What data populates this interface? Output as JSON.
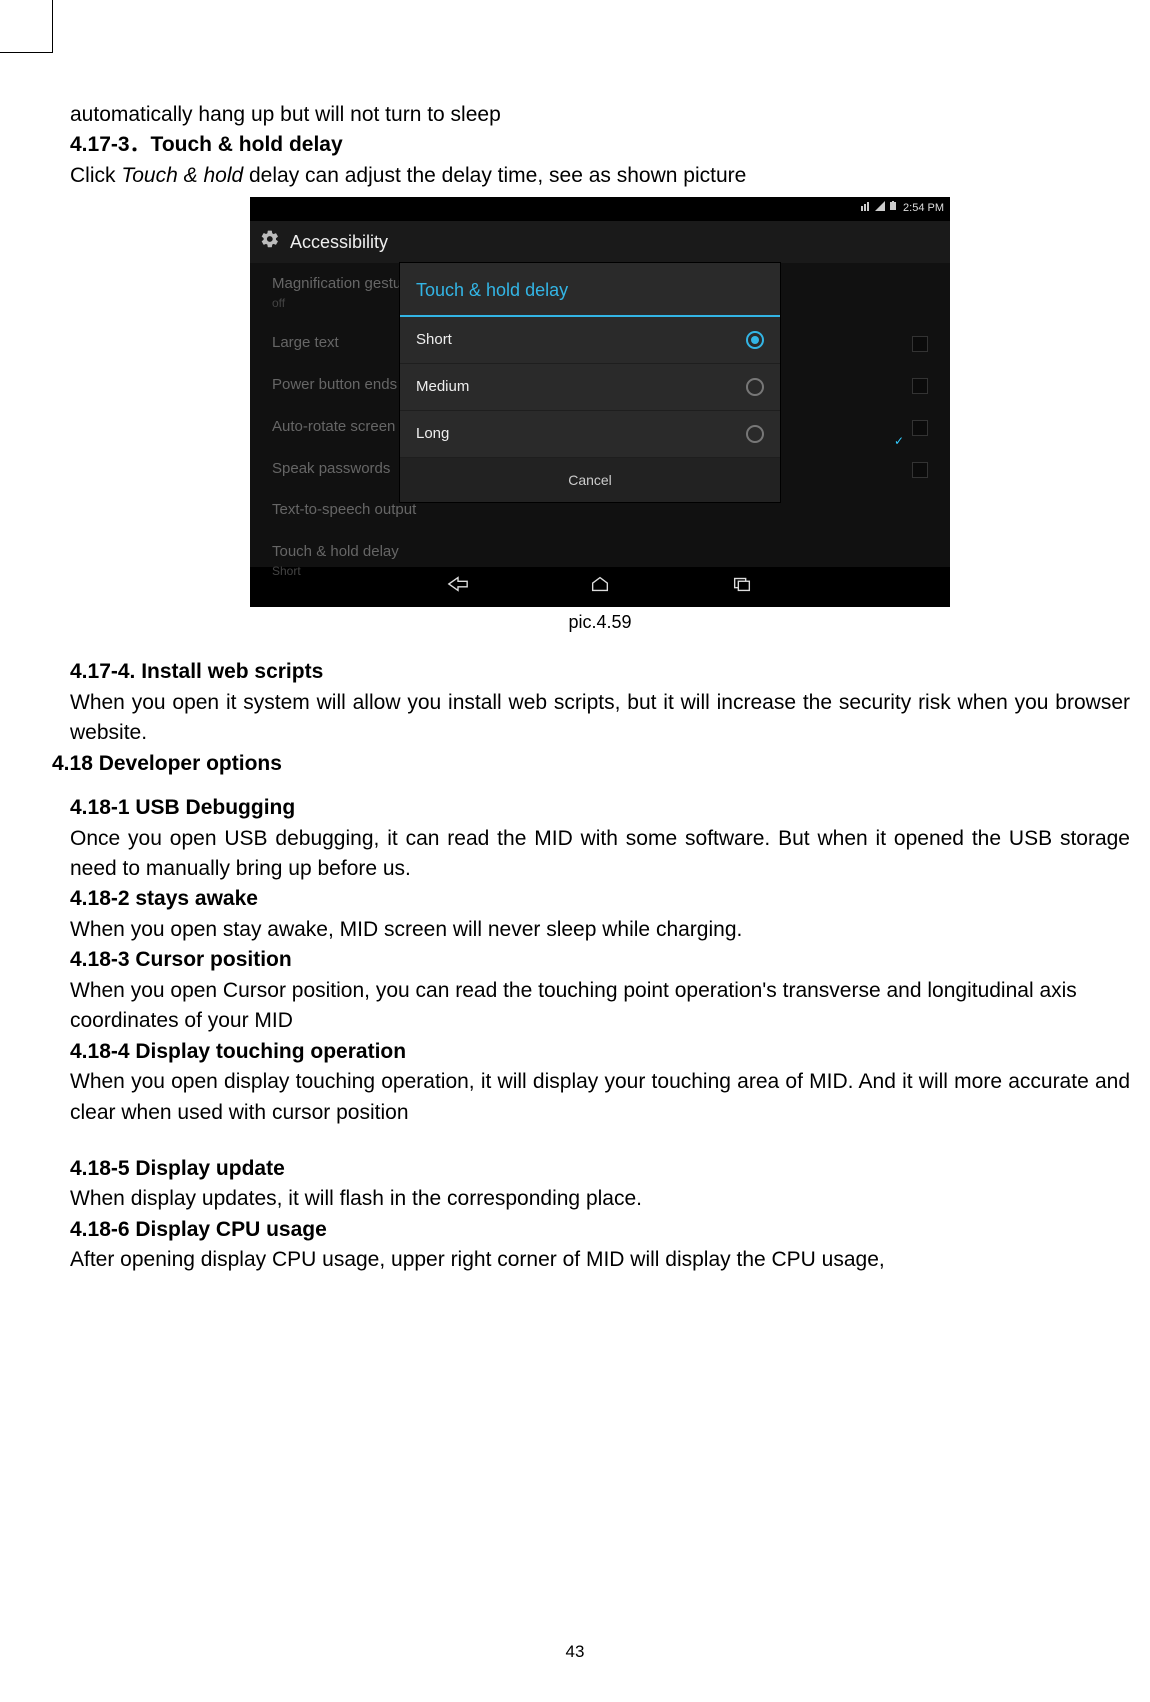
{
  "intro_line": "automatically hang up but will not turn to sleep",
  "s4_17_3": {
    "heading": "4.17-3．Touch & hold delay",
    "line_pre": "Click ",
    "line_italic": "Touch & hold",
    "line_post": " delay can adjust the delay time, see as shown picture"
  },
  "screenshot": {
    "status_time": "2:54 PM",
    "header_title": "Accessibility",
    "rows": {
      "mag": "Magnification gestures",
      "mag_sub": "off",
      "large_text": "Large text",
      "power": "Power button ends",
      "autorotate": "Auto-rotate screen",
      "speak": "Speak passwords",
      "tts": "Text-to-speech output",
      "thd": "Touch & hold delay",
      "thd_sub": "Short"
    },
    "dialog": {
      "title": "Touch & hold delay",
      "opt_short": "Short",
      "opt_medium": "Medium",
      "opt_long": "Long",
      "cancel": "Cancel"
    }
  },
  "caption": "pic.4.59",
  "s4_17_4": {
    "heading": "4.17-4. Install web scripts",
    "body": "When you open it system will allow you install web scripts, but it will increase the security risk when you browser website."
  },
  "s4_18_heading": "4.18 Developer options",
  "s4_18_1": {
    "heading": "4.18-1 USB Debugging",
    "body": "Once you open USB debugging, it can read the MID with some software. But when it opened the USB storage need to manually bring up before us."
  },
  "s4_18_2": {
    "heading": "4.18-2 stays awake",
    "body": "When you open stay awake, MID screen will never sleep while charging."
  },
  "s4_18_3": {
    "heading": "4.18-3 Cursor position",
    "body": "When you open Cursor position, you can read the touching point operation's transverse and longitudinal axis coordinates of your MID"
  },
  "s4_18_4": {
    "heading": "4.18-4 Display touching operation",
    "body": "When you open display touching operation, it will display your touching area of MID. And it will more accurate and clear when used with cursor position"
  },
  "s4_18_5": {
    "heading": "4.18-5 Display update",
    "body": "When display updates, it will flash in the corresponding place."
  },
  "s4_18_6": {
    "heading": "4.18-6 Display CPU usage",
    "body": "After opening display CPU usage, upper right corner of MID will display the CPU usage,"
  },
  "page_number": "43"
}
